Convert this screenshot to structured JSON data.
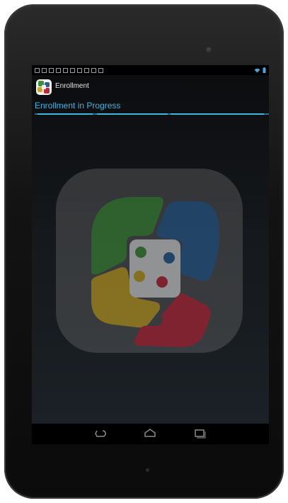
{
  "app": {
    "title": "Enrollment"
  },
  "enrollment": {
    "status_text": "Enrollment in Progress",
    "progress_state": "indeterminate"
  },
  "icons": {
    "status_bar": [
      "notification-icon",
      "notification-icon",
      "notification-icon",
      "notification-icon",
      "notification-icon",
      "notification-icon",
      "notification-icon",
      "notification-icon",
      "notification-icon",
      "notification-icon"
    ],
    "system": [
      "wifi-icon",
      "battery-icon"
    ],
    "nav": [
      "back-icon",
      "home-icon",
      "recent-apps-icon"
    ],
    "logo": "meraki-logo-icon"
  },
  "colors": {
    "accent": "#3fb6e6",
    "logo_green": "#3f8f3a",
    "logo_blue": "#2a5f95",
    "logo_yellow": "#c9a623",
    "logo_red": "#c0283a"
  }
}
